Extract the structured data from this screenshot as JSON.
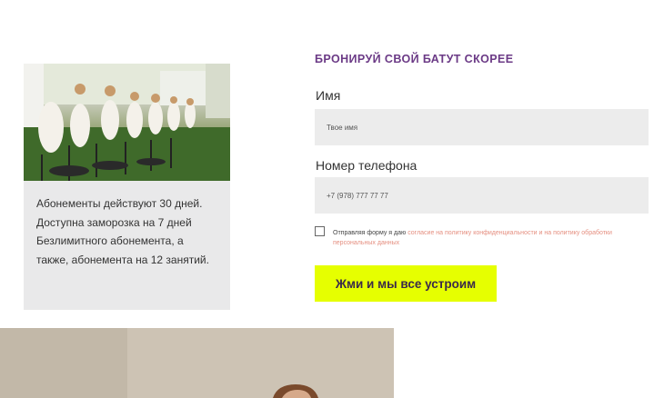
{
  "info_card": {
    "image_alt": "Group trampoline fitness class outdoors",
    "description": "Абонементы действуют 30 дней. Доступна заморозка на 7 дней Безлимитного абонемента, а также, абонемента на 12 занятий."
  },
  "form": {
    "title": "БРОНИРУЙ СВОЙ БАТУТ СКОРЕЕ",
    "name_label": "Имя",
    "name_placeholder": "Твое имя",
    "phone_label": "Номер телефона",
    "phone_placeholder": "+7 (978) 777 77 77",
    "consent_prefix": "Отправляя форму я даю",
    "consent_link": "согласие на политику конфиденциальности и на политику обработки персональных данных",
    "submit_label": "Жми и мы все устроим"
  },
  "colors": {
    "title": "#6b3a86",
    "button_bg": "#e6ff00",
    "link": "#e58f80",
    "input_bg": "#ececec",
    "card_bg": "#e9e9ea"
  }
}
